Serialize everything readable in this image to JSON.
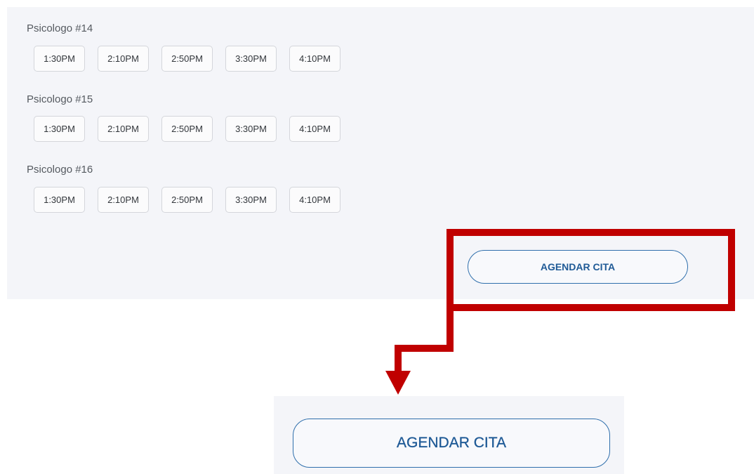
{
  "groups": [
    {
      "title": "Psicologo #14",
      "slots": [
        "1:30PM",
        "2:10PM",
        "2:50PM",
        "3:30PM",
        "4:10PM"
      ]
    },
    {
      "title": "Psicologo #15",
      "slots": [
        "1:30PM",
        "2:10PM",
        "2:50PM",
        "3:30PM",
        "4:10PM"
      ]
    },
    {
      "title": "Psicologo #16",
      "slots": [
        "1:30PM",
        "2:10PM",
        "2:50PM",
        "3:30PM",
        "4:10PM"
      ]
    }
  ],
  "cta": {
    "label": "AGENDAR CITA"
  },
  "zoom": {
    "label": "AGENDAR CITA"
  },
  "colors": {
    "highlight": "#c00000",
    "button_border": "#2f6fac",
    "button_text": "#1f5a96",
    "panel_bg": "#f4f5f9"
  }
}
